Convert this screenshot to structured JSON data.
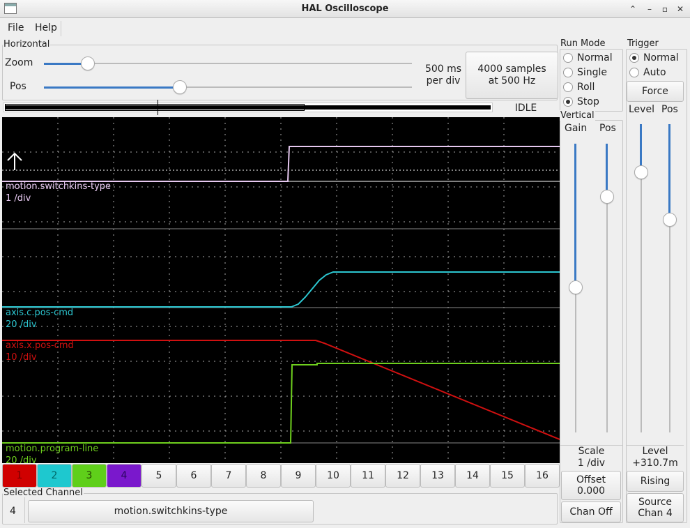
{
  "window": {
    "title": "HAL Oscilloscope"
  },
  "menu": {
    "file": "File",
    "help": "Help"
  },
  "horizontal": {
    "label": "Horizontal",
    "zoom_label": "Zoom",
    "pos_label": "Pos",
    "zoom_level": 0.12,
    "pos_level": 0.37,
    "rate_line1": "500 ms",
    "rate_line2": "per div",
    "samples_line1": "4000 samples",
    "samples_line2": "at 500 Hz",
    "status": "IDLE"
  },
  "run_mode": {
    "label": "Run Mode",
    "options": [
      "Normal",
      "Single",
      "Roll",
      "Stop"
    ],
    "selected": "Stop"
  },
  "trigger": {
    "label": "Trigger",
    "options": [
      "Normal",
      "Auto"
    ],
    "selected": "Normal",
    "force_label": "Force",
    "level_label": "Level",
    "pos_label": "Pos",
    "level_caption": "Level",
    "level_value": "+310.7m",
    "edge_button": "Rising",
    "source_line1": "Source",
    "source_line2": "Chan  4"
  },
  "vertical": {
    "label": "Vertical",
    "gain_label": "Gain",
    "pos_label": "Pos",
    "scale_caption": "Scale",
    "scale_value": "1 /div",
    "offset_caption": "Offset",
    "offset_value": "0.000",
    "chan_off_label": "Chan Off"
  },
  "traces": [
    {
      "name": "motion.switchkins-type",
      "scale": "1 /div",
      "color": "#e6c8f0"
    },
    {
      "name": "axis.c.pos-cmd",
      "scale": "20 /div",
      "color": "#2cc6d0"
    },
    {
      "name": "axis.x.pos-cmd",
      "scale": "10 /div",
      "color": "#d01010"
    },
    {
      "name": "motion.program-line",
      "scale": "20 /div",
      "color": "#6fd01e"
    }
  ],
  "channels": [
    "1",
    "2",
    "3",
    "4",
    "5",
    "6",
    "7",
    "8",
    "9",
    "10",
    "11",
    "12",
    "13",
    "14",
    "15",
    "16"
  ],
  "channel_colors": [
    "#d00000",
    "#1ec8cf",
    "#5fcf1a",
    "#7a18cc"
  ],
  "selected_channel": {
    "label": "Selected Channel",
    "number": "4",
    "name": "motion.switchkins-type"
  }
}
